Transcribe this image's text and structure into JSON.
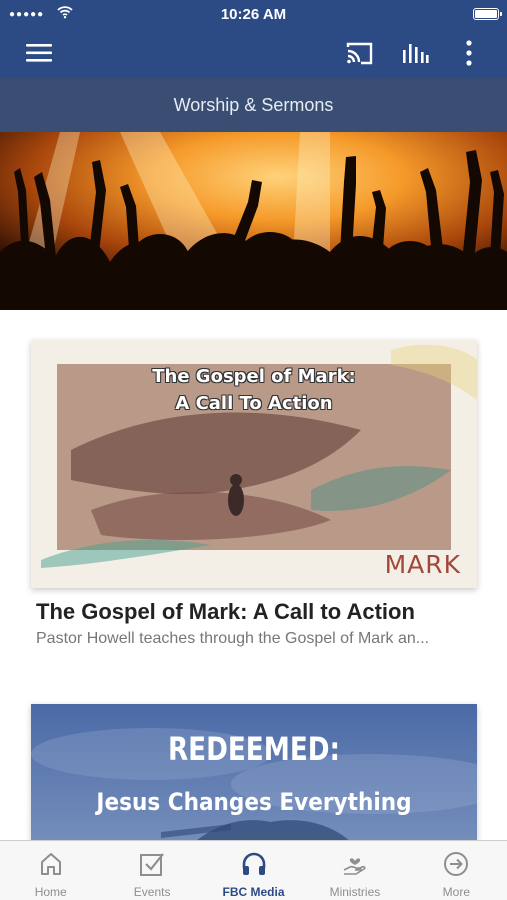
{
  "status_bar": {
    "signal": "●●●●●",
    "time": "10:26 AM"
  },
  "app_bar": {
    "icons": [
      "menu-icon",
      "cast-icon",
      "equalizer-icon",
      "more-vert-icon"
    ],
    "color": "#2c4a84"
  },
  "subheader": {
    "title": "Worship & Sermons",
    "color": "#3a4e74"
  },
  "hero": {
    "image": "worship-crowd-raised-hands"
  },
  "cards": [
    {
      "image_title_line1": "The Gospel of Mark:",
      "image_title_line2": "A Call To Action",
      "image_brand": "MARK",
      "title": "The Gospel of Mark: A Call to Action",
      "description": "Pastor Howell teaches through the Gospel of Mark an..."
    },
    {
      "image_title_line1": "REDEEMED:",
      "image_title_line2": "Jesus Changes Everything"
    }
  ],
  "tab_bar": {
    "active_color": "#2c4a84",
    "tabs": [
      {
        "label": "Home",
        "icon": "home-icon",
        "active": false
      },
      {
        "label": "Events",
        "icon": "checkbox-icon",
        "active": false
      },
      {
        "label": "FBC Media",
        "icon": "headphones-icon",
        "active": true
      },
      {
        "label": "Ministries",
        "icon": "hand-heart-icon",
        "active": false
      },
      {
        "label": "More",
        "icon": "arrow-circle-icon",
        "active": false
      }
    ]
  }
}
